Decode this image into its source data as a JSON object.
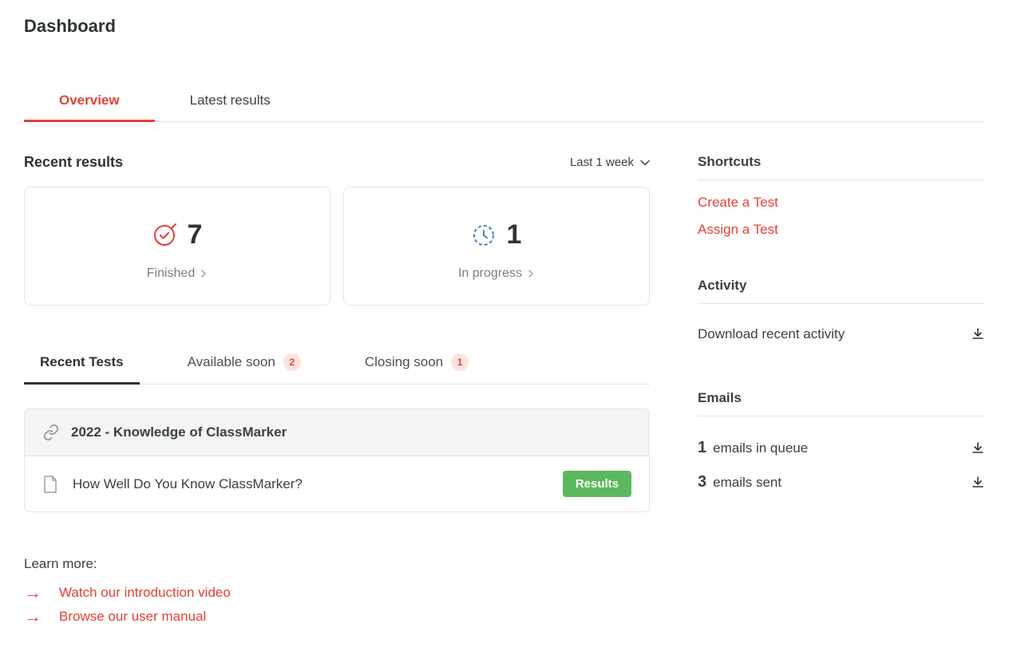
{
  "page_title": "Dashboard",
  "tabs": {
    "overview": "Overview",
    "latest_results": "Latest results"
  },
  "recent_results": {
    "title": "Recent results",
    "filter": "Last 1 week",
    "finished": {
      "count": "7",
      "label": "Finished"
    },
    "in_progress": {
      "count": "1",
      "label": "In progress"
    }
  },
  "sub_tabs": {
    "recent_tests": "Recent Tests",
    "available_soon": {
      "label": "Available soon",
      "count": "2"
    },
    "closing_soon": {
      "label": "Closing soon",
      "count": "1"
    }
  },
  "test_list": {
    "header": "2022 - Knowledge of ClassMarker",
    "item_title": "How Well Do You Know ClassMarker?",
    "results_btn": "Results"
  },
  "learn_more": {
    "title": "Learn more:",
    "video": "Watch our introduction video",
    "manual": "Browse our user manual"
  },
  "shortcuts": {
    "title": "Shortcuts",
    "create": "Create a Test",
    "assign": "Assign a Test"
  },
  "activity": {
    "title": "Activity",
    "download": "Download recent activity"
  },
  "emails": {
    "title": "Emails",
    "queue_count": "1",
    "queue_label": "emails in queue",
    "sent_count": "3",
    "sent_label": "emails sent"
  }
}
